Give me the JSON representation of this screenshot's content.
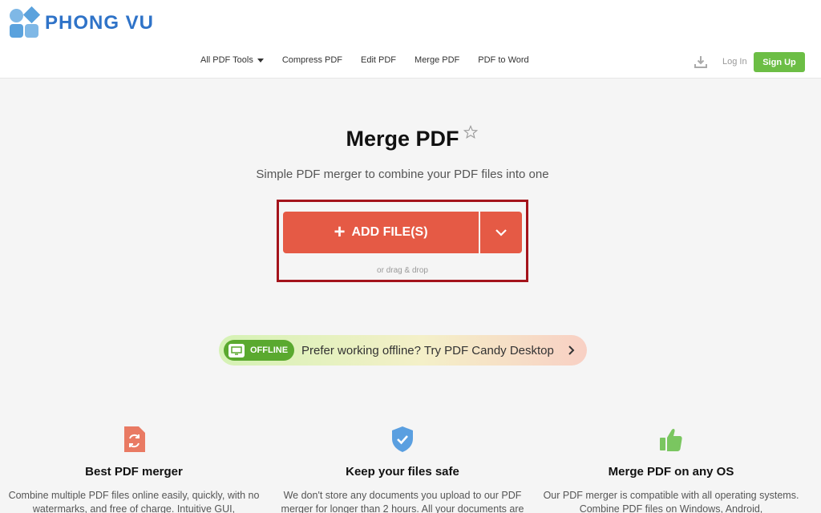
{
  "brand": {
    "name": "PHONG VU"
  },
  "nav": {
    "items": [
      "All PDF Tools",
      "Compress PDF",
      "Edit PDF",
      "Merge PDF",
      "PDF to Word"
    ],
    "login": "Log In",
    "signup": "Sign Up"
  },
  "main": {
    "title": "Merge PDF",
    "subtitle": "Simple PDF merger to combine your PDF files into one",
    "add_files_label": "ADD FILE(S)",
    "drag_hint": "or drag & drop"
  },
  "offline": {
    "badge": "OFFLINE",
    "text": "Prefer working offline? Try PDF Candy Desktop"
  },
  "features": [
    {
      "icon": "refresh-file-icon",
      "title": "Best PDF merger",
      "text": "Combine multiple PDF files online easily, quickly, with no watermarks, and free of charge. Intuitive GUI,"
    },
    {
      "icon": "shield-check-icon",
      "title": "Keep your files safe",
      "text": "We don't store any documents you upload to our PDF merger for longer than 2 hours. All your documents are"
    },
    {
      "icon": "thumbs-up-icon",
      "title": "Merge PDF on any OS",
      "text": "Our PDF merger is compatible with all operating systems. Combine PDF files on Windows, Android,"
    }
  ],
  "colors": {
    "brand": "#2f73c8",
    "accent": "#e55a45",
    "signup": "#6cbe45",
    "highlight": "#a4141c",
    "offline_badge": "#5aa92f"
  }
}
